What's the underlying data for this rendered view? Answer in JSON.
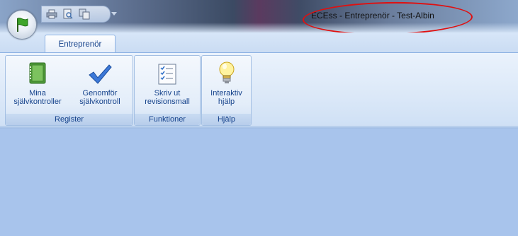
{
  "window": {
    "title": "ECEss - Entreprenör - Test-Albin"
  },
  "quick_access": {
    "icons": [
      "print-icon",
      "print-preview-icon",
      "copy-icon",
      "customize-dropdown-icon"
    ]
  },
  "tabs": [
    {
      "label": "Entreprenör",
      "active": true
    }
  ],
  "ribbon": {
    "groups": [
      {
        "label": "Register",
        "buttons": [
          {
            "line1": "Mina",
            "line2": "självkontroller",
            "icon": "book-icon"
          },
          {
            "line1": "Genomför",
            "line2": "självkontroll",
            "icon": "checkmark-icon"
          }
        ]
      },
      {
        "label": "Funktioner",
        "buttons": [
          {
            "line1": "Skriv ut",
            "line2": "revisionsmall",
            "icon": "checklist-icon"
          }
        ]
      },
      {
        "label": "Hjälp",
        "buttons": [
          {
            "line1": "Interaktiv",
            "line2": "hjälp",
            "icon": "lightbulb-icon"
          }
        ]
      }
    ]
  },
  "colors": {
    "ribbon_text": "#15428b",
    "content_bg": "#a8c4ec",
    "annotation": "#e01010"
  }
}
